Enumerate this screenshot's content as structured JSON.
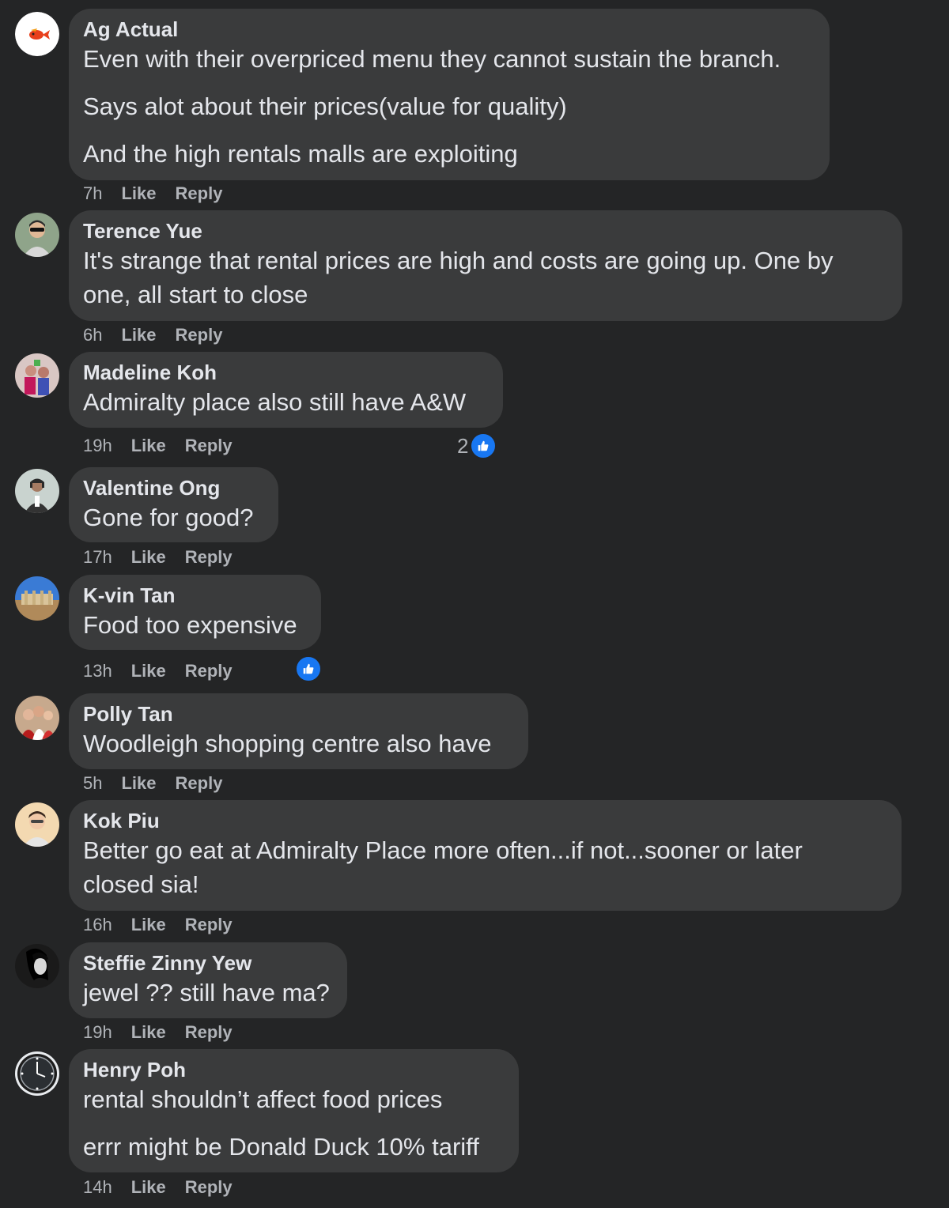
{
  "actions": {
    "like_label": "Like",
    "reply_label": "Reply"
  },
  "colors": {
    "background": "#242526",
    "bubble": "#3a3b3c",
    "text": "#e4e6eb",
    "secondary": "#b0b3b8",
    "like_blue": "#1877f2"
  },
  "comments": [
    {
      "author": "Ag Actual",
      "avatar_icon": "goldfish-avatar-icon",
      "paragraphs": [
        "Even with their overpriced menu they cannot sustain the branch.",
        "Says alot about their prices(value for quality)",
        "And the high rentals malls are exploiting"
      ],
      "time": "7h"
    },
    {
      "author": "Terence Yue",
      "avatar_icon": "person-avatar-icon",
      "paragraphs": [
        "It's strange that rental prices are high and costs are going up. One by\none, all start to close"
      ],
      "time": "6h"
    },
    {
      "author": "Madeline Koh",
      "avatar_icon": "group-photo-avatar-icon",
      "paragraphs": [
        "Admiralty place also still have A&W"
      ],
      "time": "19h",
      "reaction_count": "2"
    },
    {
      "author": "Valentine Ong",
      "avatar_icon": "person-avatar-icon",
      "paragraphs": [
        "Gone for good?"
      ],
      "time": "17h"
    },
    {
      "author": "K-vin Tan",
      "avatar_icon": "landscape-avatar-icon",
      "paragraphs": [
        "Food too expensive"
      ],
      "time": "13h",
      "reaction_count": ""
    },
    {
      "author": "Polly Tan",
      "avatar_icon": "group-photo-avatar-icon",
      "paragraphs": [
        "Woodleigh shopping centre also have"
      ],
      "time": "5h"
    },
    {
      "author": "Kok Piu",
      "avatar_icon": "person-avatar-icon",
      "paragraphs": [
        "Better go eat at Admiralty Place more often...if not...sooner or later\nclosed sia!"
      ],
      "time": "16h"
    },
    {
      "author": "Steffie Zinny Yew",
      "avatar_icon": "portrait-avatar-icon",
      "paragraphs": [
        "jewel ?? still have ma?"
      ],
      "time": "19h"
    },
    {
      "author": "Henry Poh",
      "avatar_icon": "watch-avatar-icon",
      "paragraphs": [
        "rental shouldn’t affect food prices",
        "errr might be Donald Duck 10% tariff"
      ],
      "time": "14h"
    }
  ]
}
